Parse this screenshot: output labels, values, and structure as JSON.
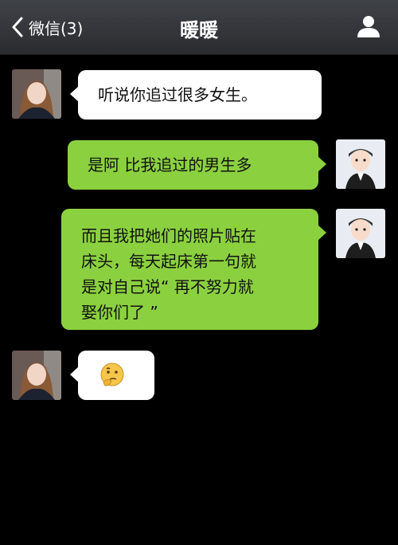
{
  "header": {
    "back_label": "微信(3)",
    "title": "暖暖"
  },
  "messages": [
    {
      "sender": "other",
      "text": "听说你追过很多女生。"
    },
    {
      "sender": "me",
      "text": "是阿 比我追过的男生多"
    },
    {
      "sender": "me",
      "lines": [
        "而且我把她们的照片贴在",
        "床头，每天起床第一句就",
        "是对自己说“ 再不努力就",
        "娶你们了 ”"
      ]
    },
    {
      "sender": "other",
      "emoji": "thinking-face-icon"
    }
  ],
  "colors": {
    "header_bg": "#35383c",
    "chat_bg": "#000000",
    "my_bubble": "#8bd13f",
    "other_bubble": "#ffffff"
  }
}
